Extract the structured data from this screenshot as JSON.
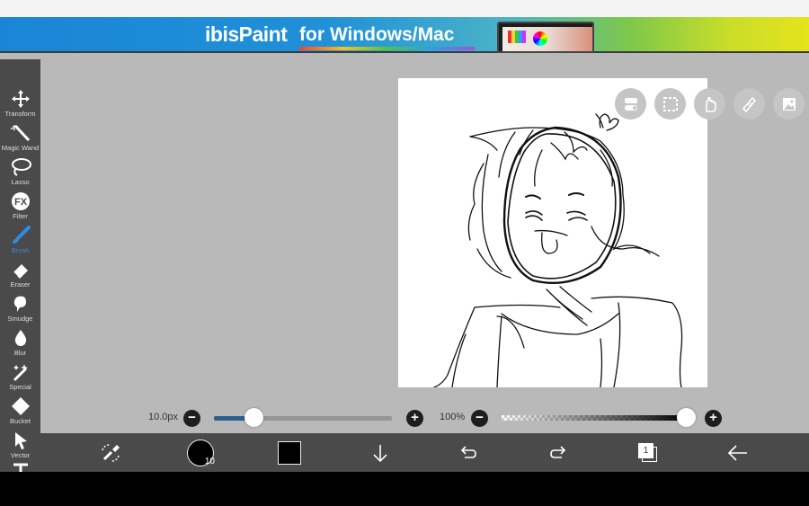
{
  "ad": {
    "logo": "ibisPaint",
    "text": "for Windows/Mac"
  },
  "tools": [
    {
      "label": "Transform",
      "icon": "move-arrows-icon"
    },
    {
      "label": "Magic Wand",
      "icon": "magic-wand-icon"
    },
    {
      "label": "Lasso",
      "icon": "lasso-icon"
    },
    {
      "label": "Filter",
      "icon": "fx-icon"
    },
    {
      "label": "Brush",
      "icon": "brush-icon",
      "active": true
    },
    {
      "label": "Eraser",
      "icon": "eraser-icon"
    },
    {
      "label": "Smudge",
      "icon": "smudge-icon"
    },
    {
      "label": "Blur",
      "icon": "drop-icon"
    },
    {
      "label": "Special",
      "icon": "special-sparkle-icon"
    },
    {
      "label": "Bucket",
      "icon": "bucket-icon"
    },
    {
      "label": "Vector",
      "icon": "cursor-icon"
    },
    {
      "label": "",
      "icon": "text-icon"
    }
  ],
  "brush": {
    "size_label": "10.0px",
    "size_fraction": 0.22
  },
  "opacity": {
    "label": "100%",
    "value_fraction": 1.0
  },
  "color_button": {
    "brush_size_badge": "10"
  },
  "layers": {
    "count": "1"
  },
  "colors": {
    "accent": "#2b8de6",
    "toolbar_bg": "#4a4a4a",
    "workspace_bg": "#b9b9b9",
    "current_color": "#000000"
  }
}
